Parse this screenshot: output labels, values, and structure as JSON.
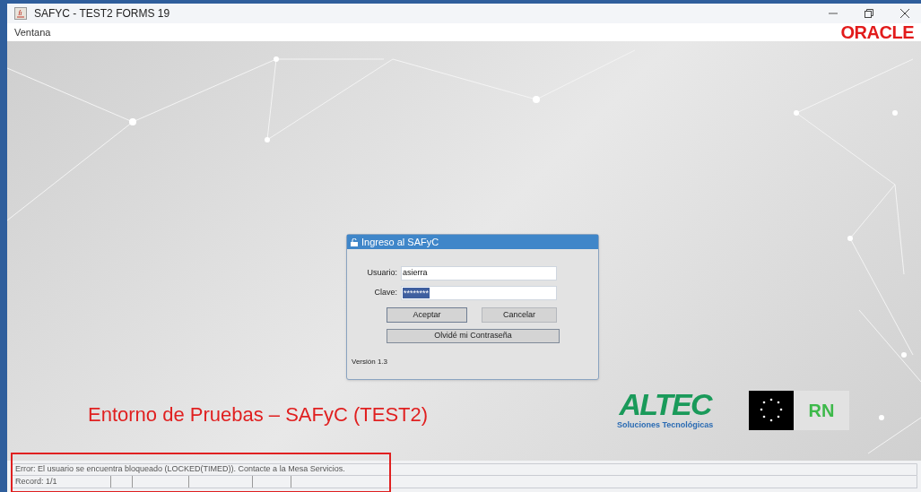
{
  "window": {
    "title": "SAFYC - TEST2 FORMS 19"
  },
  "menu": [
    "Ventana"
  ],
  "brand": "ORACLE",
  "dialog": {
    "title": "Ingreso al SAFyC",
    "fields": [
      {
        "label": "Usuario:",
        "value": "asierra",
        "selected": false
      },
      {
        "label": "Clave:",
        "value": "********",
        "selected": true
      }
    ],
    "buttons": [
      "Aceptar",
      "Cancelar"
    ],
    "link_button": "Olvidé mi Contraseña",
    "version": "Versión 1.3"
  },
  "banner": "Entorno de Pruebas – SAFyC (TEST2)",
  "logos": {
    "altec": "ALTEC",
    "altec_subtitle": "Soluciones Tecnológicas",
    "province": "RN"
  },
  "status_bar": {
    "message": "Error: El usuario se encuentra bloqueado (LOCKED(TIMED)). Contacte a la Mesa Servicios.",
    "record": "Record: 1/1"
  }
}
